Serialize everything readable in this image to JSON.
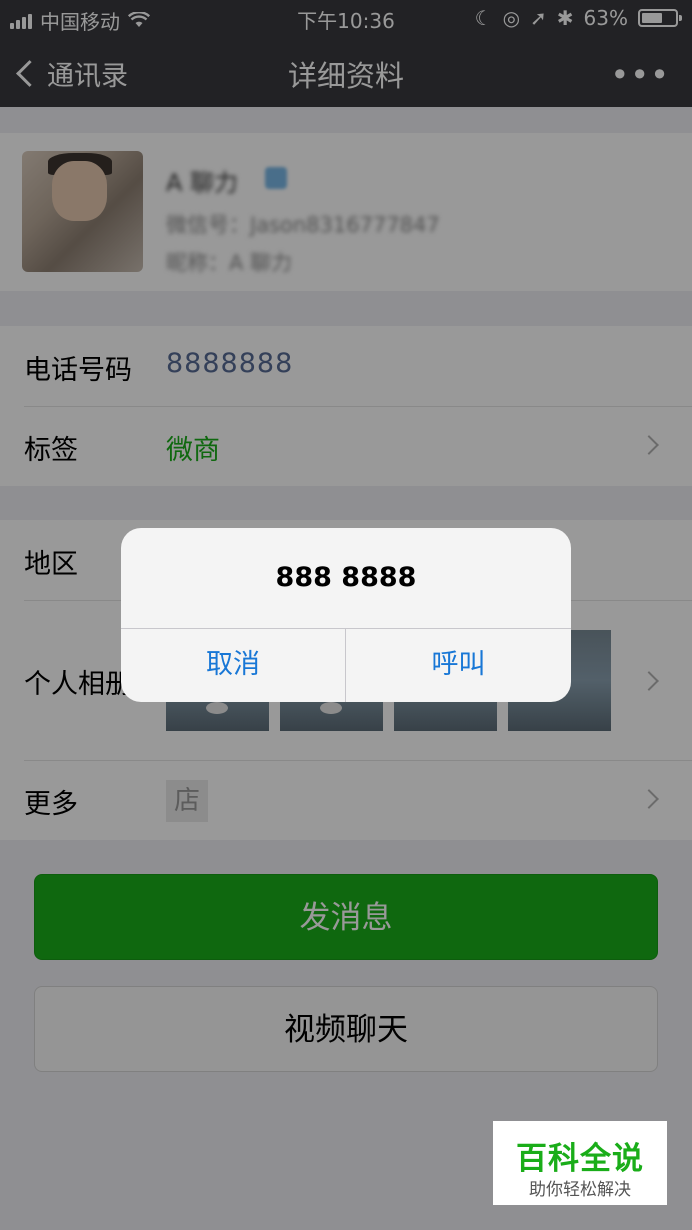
{
  "status_bar": {
    "carrier": "中国移动",
    "time": "下午10:36",
    "battery_percent": "63%",
    "battery_level": 0.63
  },
  "nav": {
    "back_label": "通讯录",
    "title": "详细资料",
    "more_label": "•••"
  },
  "profile": {
    "name": "A 聊力",
    "wechat_id": "微信号：Jason8316777847",
    "nickname": "昵称：A 聊力"
  },
  "rows": {
    "phone_label": "电话号码",
    "phone_value": "8888888",
    "tags_label": "标签",
    "tags_value": "微商",
    "region_label": "地区",
    "album_label": "个人相册",
    "more_label": "更多",
    "store_icon_text": "店"
  },
  "buttons": {
    "send_message": "发消息",
    "video_chat": "视频聊天"
  },
  "alert": {
    "message": "888 8888",
    "cancel": "取消",
    "call": "呼叫"
  },
  "watermark": {
    "title": "百科全说",
    "subtitle": "助你轻松解决"
  },
  "colors": {
    "nav_bg": "#393a3f",
    "primary_green": "#1aad19",
    "link_blue": "#1877d6",
    "phone_text": "#576b95"
  }
}
